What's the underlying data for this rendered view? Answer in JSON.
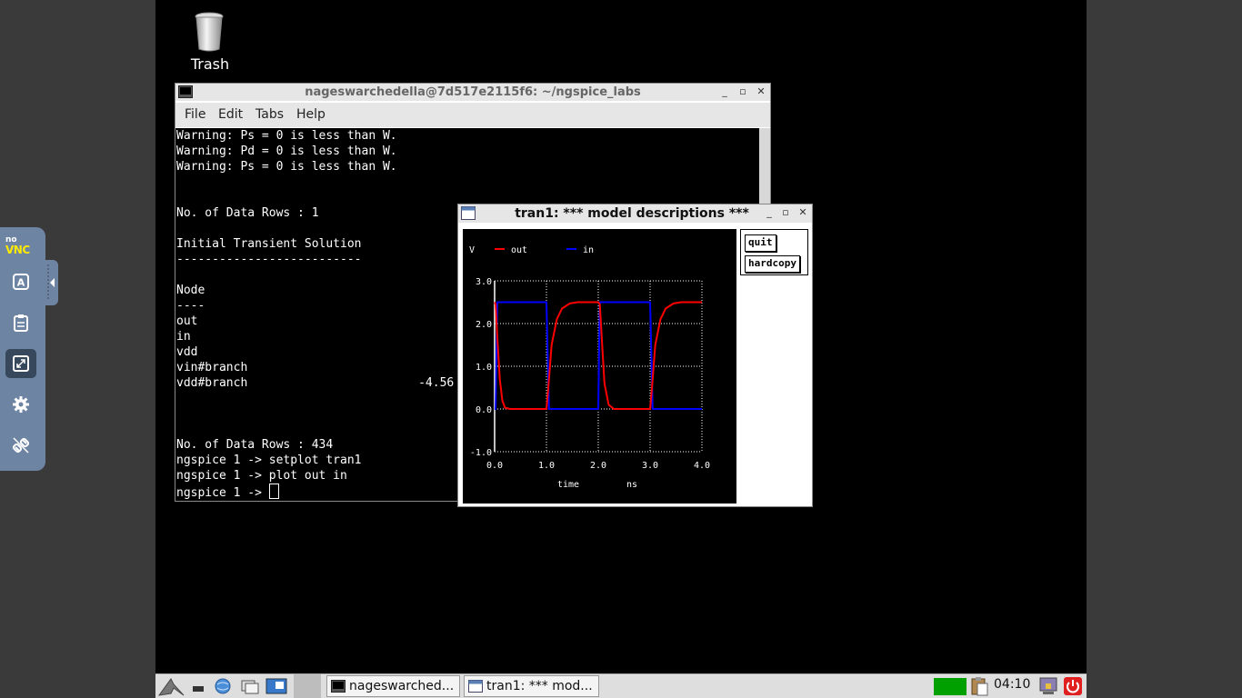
{
  "desktop": {
    "trash_label": "Trash"
  },
  "novnc": {
    "logo_top": "no",
    "logo_bottom": "VNC",
    "buttons": [
      "keyboard-icon",
      "clipboard-icon",
      "fullscreen-icon",
      "settings-icon",
      "disconnect-icon"
    ]
  },
  "terminal": {
    "title": "nageswarchedella@7d517e2115f6: ~/ngspice_labs",
    "menu": [
      "File",
      "Edit",
      "Tabs",
      "Help"
    ],
    "lines": [
      "Warning: Ps = 0 is less than W.",
      "Warning: Pd = 0 is less than W.",
      "Warning: Ps = 0 is less than W.",
      "",
      "",
      "No. of Data Rows : 1",
      "",
      "Initial Transient Solution",
      "--------------------------",
      "",
      "Node",
      "----",
      "out",
      "in",
      "vdd",
      "vin#branch",
      "vdd#branch                        -4.56",
      "",
      "",
      "",
      "No. of Data Rows : 434",
      "ngspice 1 -> setplot tran1",
      "ngspice 1 -> plot out in",
      "ngspice 1 -> "
    ]
  },
  "plot_window": {
    "title": "tran1: *** model descriptions ***",
    "buttons": {
      "quit": "quit",
      "hardcopy": "hardcopy"
    }
  },
  "chart_data": {
    "type": "line",
    "ylabel_unit": "V",
    "xlabel": "time",
    "xunit": "ns",
    "xlim": [
      0.0,
      4.0
    ],
    "ylim": [
      -1.0,
      3.0
    ],
    "xticks": [
      "0.0",
      "1.0",
      "2.0",
      "3.0",
      "4.0"
    ],
    "yticks": [
      "-1.0",
      "0.0",
      "1.0",
      "2.0",
      "3.0"
    ],
    "grid": true,
    "legend_position": "top",
    "series": [
      {
        "name": "out",
        "color": "#ff0000",
        "x": [
          0.0,
          0.02,
          0.05,
          0.1,
          0.15,
          0.2,
          0.3,
          1.0,
          1.03,
          1.1,
          1.2,
          1.3,
          1.45,
          1.6,
          2.0,
          2.03,
          2.07,
          2.12,
          2.2,
          2.3,
          3.0,
          3.03,
          3.1,
          3.2,
          3.3,
          3.45,
          3.6,
          4.0
        ],
        "y": [
          2.5,
          2.45,
          1.7,
          0.7,
          0.2,
          0.03,
          0.0,
          0.0,
          0.4,
          1.5,
          2.1,
          2.35,
          2.47,
          2.5,
          2.5,
          2.45,
          1.6,
          0.6,
          0.1,
          0.0,
          0.0,
          0.4,
          1.5,
          2.1,
          2.35,
          2.47,
          2.5,
          2.5
        ]
      },
      {
        "name": "in",
        "color": "#0000ff",
        "x": [
          0.0,
          0.02,
          0.05,
          1.0,
          1.05,
          2.0,
          2.03,
          3.0,
          3.05,
          4.0
        ],
        "y": [
          0.0,
          0.0,
          2.5,
          2.5,
          0.0,
          0.0,
          2.5,
          2.5,
          0.0,
          0.0
        ]
      }
    ]
  },
  "taskbar": {
    "tasks": [
      "nageswarched...",
      "tran1: *** mod..."
    ],
    "clock": "04:10"
  }
}
